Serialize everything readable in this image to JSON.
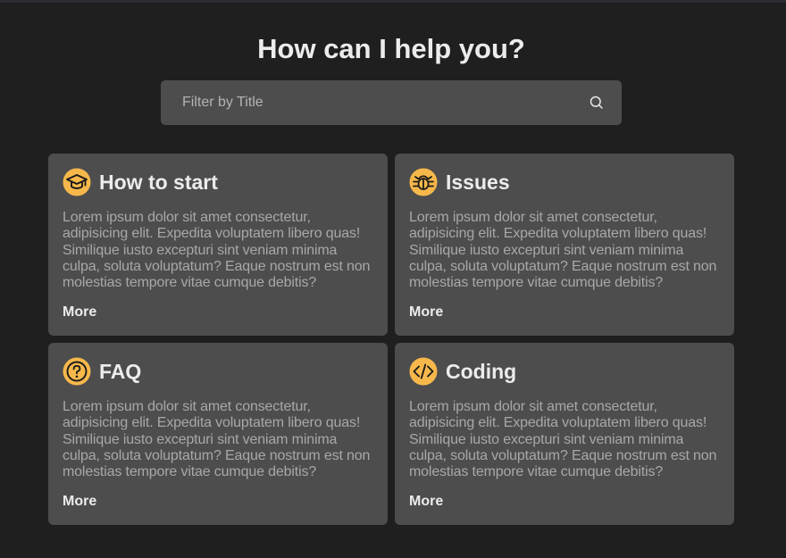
{
  "page": {
    "title": "How can I help you?"
  },
  "search": {
    "placeholder": "Filter by Title",
    "value": "",
    "icon": "search-icon"
  },
  "colors": {
    "background": "#1f1f1f",
    "card": "#4d4d4d",
    "accent": "#f7b84b",
    "text": "#ececec",
    "muted_text": "#a8a8a8"
  },
  "cards": [
    {
      "title": "How to start",
      "icon": "graduation-cap-icon",
      "body": "Lorem ipsum dolor sit amet consectetur, adipisicing elit. Expedita voluptatem libero quas! Similique iusto excepturi sint veniam minima culpa, soluta voluptatum? Eaque nostrum est non molestias tempore vitae cumque debitis?",
      "more_label": "More"
    },
    {
      "title": "Issues",
      "icon": "bug-icon",
      "body": "Lorem ipsum dolor sit amet consectetur, adipisicing elit. Expedita voluptatem libero quas! Similique iusto excepturi sint veniam minima culpa, soluta voluptatum? Eaque nostrum est non molestias tempore vitae cumque debitis?",
      "more_label": "More"
    },
    {
      "title": "FAQ",
      "icon": "question-circle-icon",
      "body": "Lorem ipsum dolor sit amet consectetur, adipisicing elit. Expedita voluptatem libero quas! Similique iusto excepturi sint veniam minima culpa, soluta voluptatum? Eaque nostrum est non molestias tempore vitae cumque debitis?",
      "more_label": "More"
    },
    {
      "title": "Coding",
      "icon": "code-icon",
      "body": "Lorem ipsum dolor sit amet consectetur, adipisicing elit. Expedita voluptatem libero quas! Similique iusto excepturi sint veniam minima culpa, soluta voluptatum? Eaque nostrum est non molestias tempore vitae cumque debitis?",
      "more_label": "More"
    }
  ]
}
